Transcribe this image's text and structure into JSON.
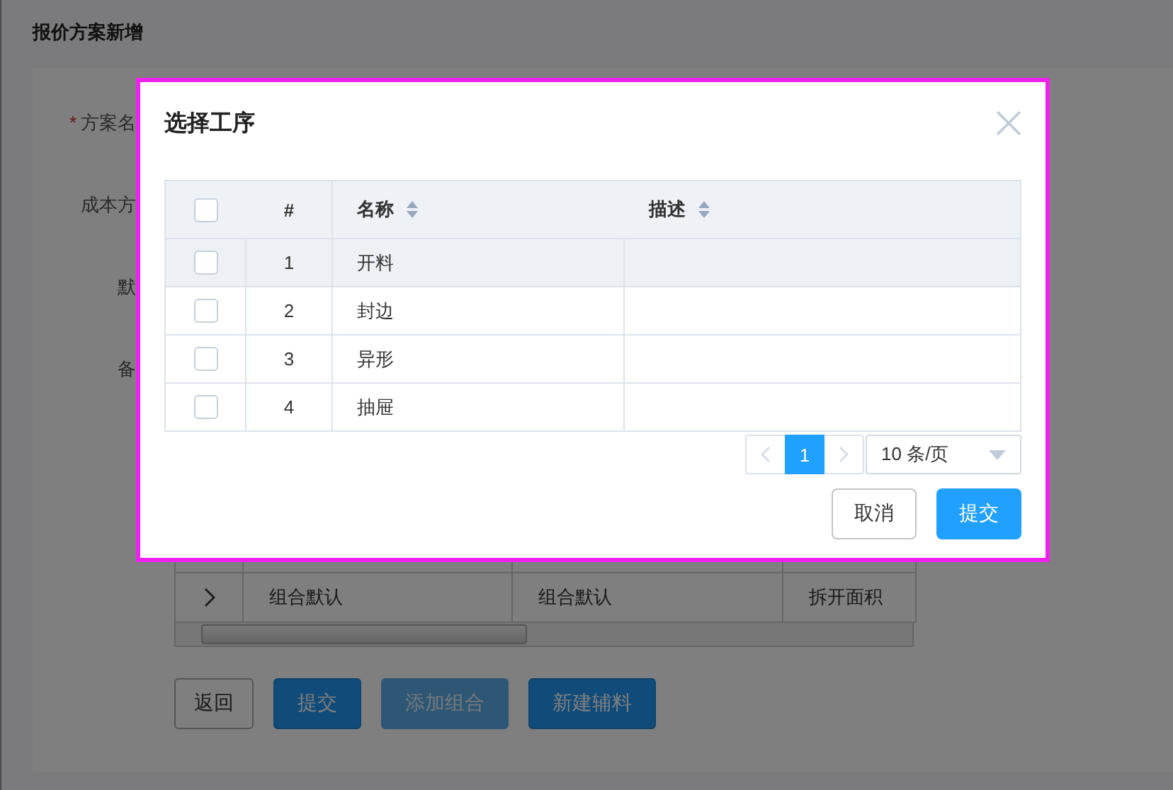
{
  "page": {
    "title": "报价方案新增",
    "form_labels": [
      {
        "label": "方案名",
        "required_mark": "*"
      },
      {
        "label": "成本方"
      },
      {
        "label": "默"
      },
      {
        "label": "备"
      }
    ],
    "table": {
      "rows": [
        {
          "cells": [
            "组合默认",
            "组合默认",
            "拆开面积"
          ]
        }
      ]
    },
    "buttons": [
      {
        "label": "返回",
        "kind": "default",
        "disabled": false
      },
      {
        "label": "提交",
        "kind": "primary",
        "disabled": false
      },
      {
        "label": "添加组合",
        "kind": "primary",
        "disabled": true
      },
      {
        "label": "新建辅料",
        "kind": "primary",
        "disabled": false
      }
    ]
  },
  "dialog": {
    "title": "选择工序",
    "all_checked": false,
    "columns": [
      {
        "label": "#",
        "sortable": false
      },
      {
        "label": "名称",
        "sortable": true
      },
      {
        "label": "描述",
        "sortable": true
      }
    ],
    "rows": [
      {
        "index": "1",
        "name": "开料",
        "checked": false,
        "highlighted": true
      },
      {
        "index": "2",
        "name": "封边",
        "checked": false,
        "highlighted": false
      },
      {
        "index": "3",
        "name": "异形",
        "checked": false,
        "highlighted": false
      },
      {
        "index": "4",
        "name": "抽屉",
        "checked": false,
        "highlighted": false
      }
    ],
    "pagination": {
      "pages": [
        {
          "label": "1",
          "selected": true
        }
      ],
      "page_size": "10 条/页"
    },
    "buttons": [
      {
        "label": "取消",
        "kind": "default"
      },
      {
        "label": "提交",
        "kind": "primary"
      }
    ]
  }
}
